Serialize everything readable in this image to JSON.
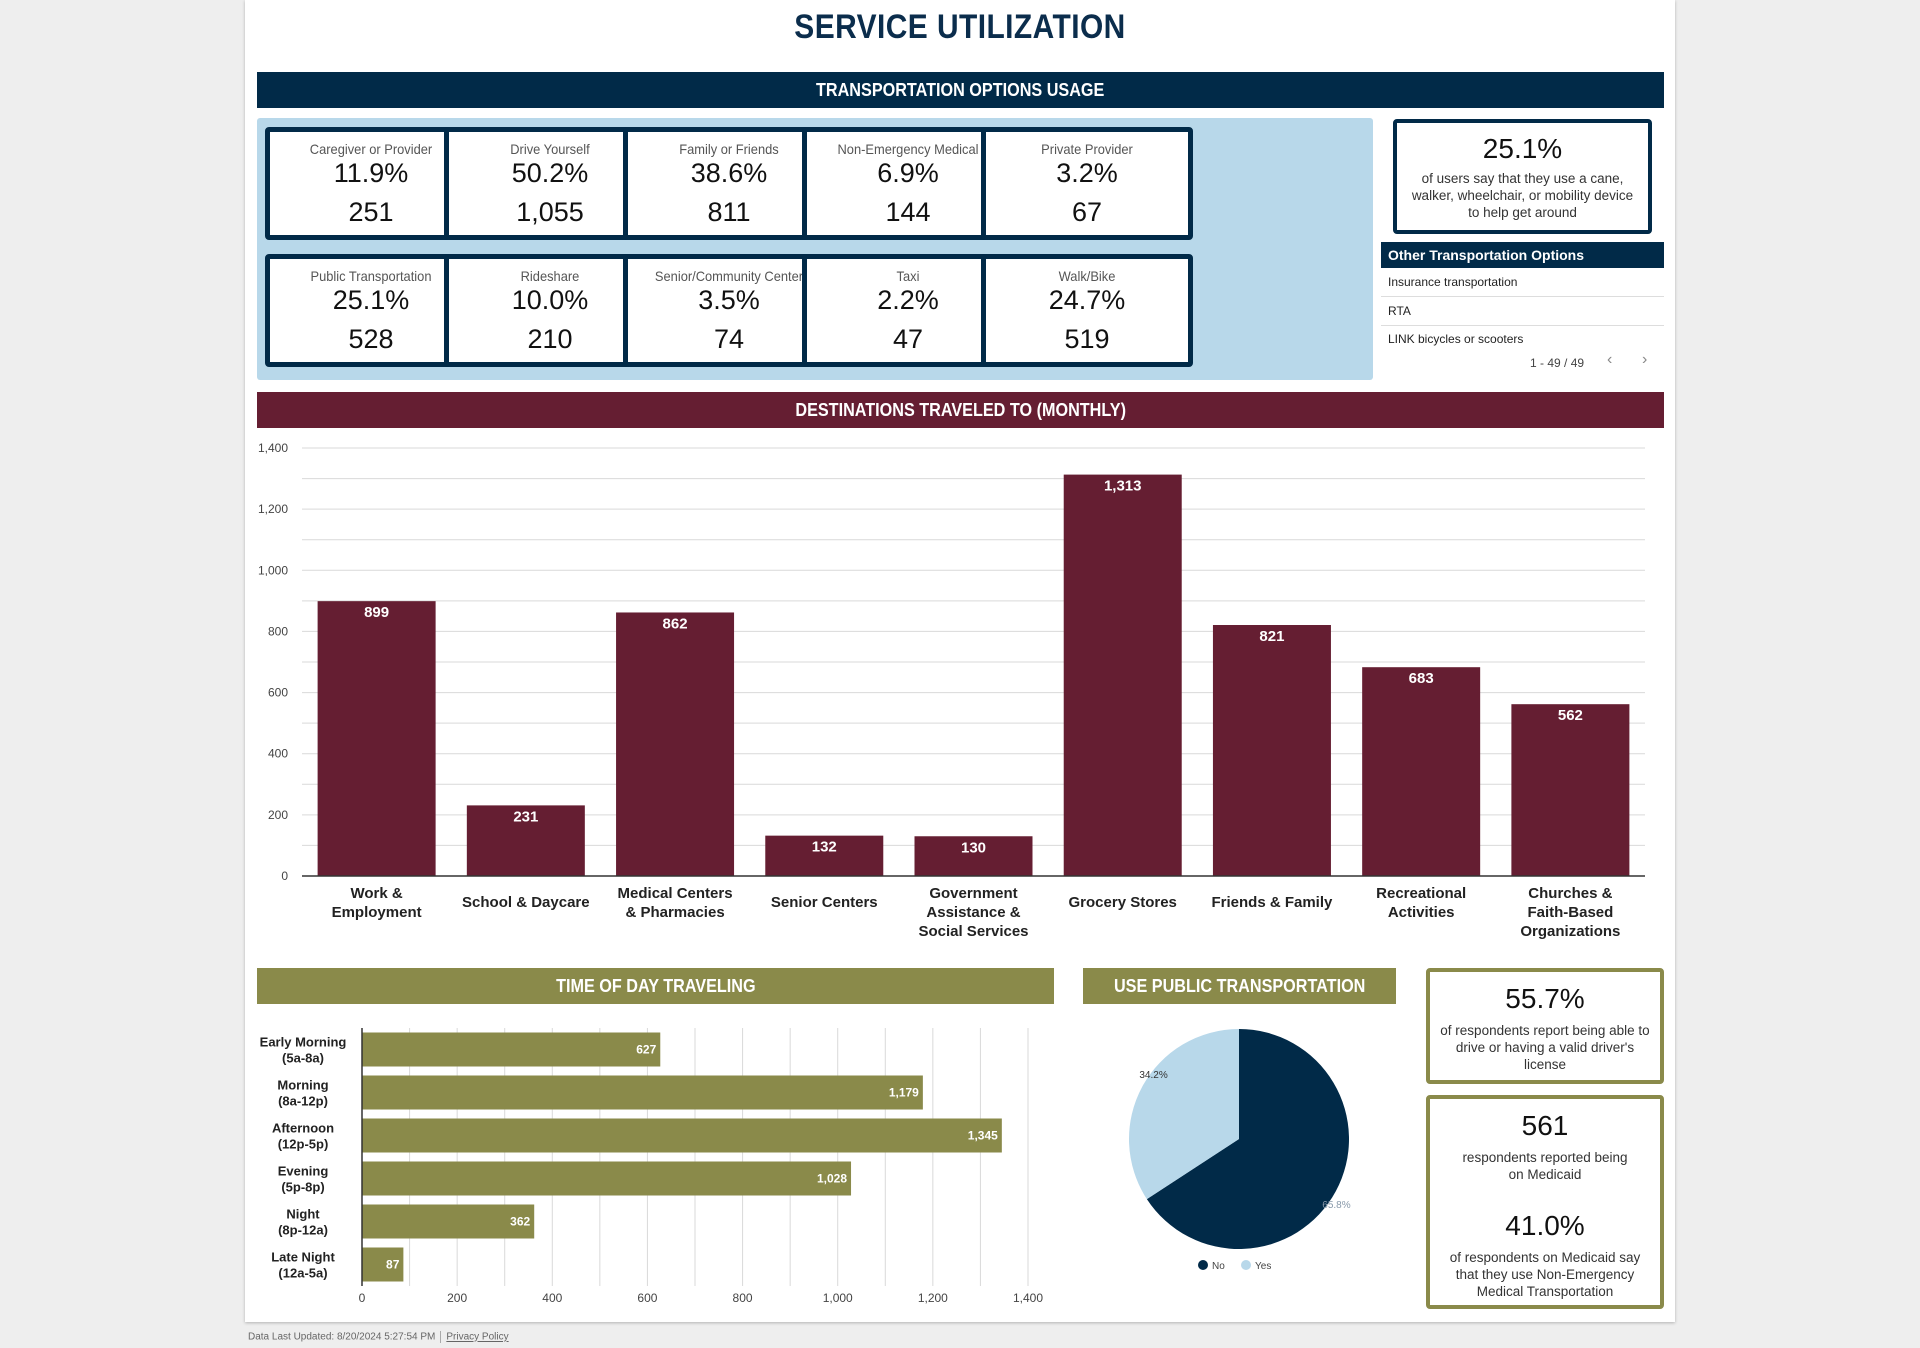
{
  "page": {
    "title": "SERVICE UTILIZATION"
  },
  "transportation": {
    "header": "TRANSPORTATION OPTIONS USAGE",
    "cards": [
      {
        "label": "Caregiver or Provider",
        "percent": "11.9%",
        "count": "251"
      },
      {
        "label": "Drive Yourself",
        "percent": "50.2%",
        "count": "1,055"
      },
      {
        "label": "Family or Friends",
        "percent": "38.6%",
        "count": "811"
      },
      {
        "label": "Non-Emergency Medical",
        "percent": "6.9%",
        "count": "144"
      },
      {
        "label": "Private Provider",
        "percent": "3.2%",
        "count": "67"
      },
      {
        "label": "Public Transportation",
        "percent": "25.1%",
        "count": "528"
      },
      {
        "label": "Rideshare",
        "percent": "10.0%",
        "count": "210"
      },
      {
        "label": "Senior/Community Center",
        "percent": "3.5%",
        "count": "74"
      },
      {
        "label": "Taxi",
        "percent": "2.2%",
        "count": "47"
      },
      {
        "label": "Walk/Bike",
        "percent": "24.7%",
        "count": "519"
      }
    ],
    "mobility_stat": {
      "value": "25.1%",
      "description": "of users say that they use a cane, walker, wheelchair, or mobility device to help get around"
    },
    "other_options": {
      "header": "Other Transportation Options",
      "items": [
        "Insurance transportation",
        "RTA",
        "LINK bicycles or scooters"
      ],
      "pagination": "1 - 49 / 49",
      "prev_icon": "‹",
      "next_icon": "›"
    }
  },
  "destinations": {
    "header": "DESTINATIONS TRAVELED TO (MONTHLY)"
  },
  "time_of_day": {
    "header": "TIME OF DAY TRAVELING"
  },
  "public_transport": {
    "header": "USE PUBLIC TRANSPORTATION"
  },
  "stats": {
    "license": {
      "value": "55.7%",
      "description": "of respondents report being able to drive or having a valid driver's license"
    },
    "medicaid": {
      "value": "561",
      "description": "respondents reported being on Medicaid"
    },
    "nemt": {
      "value": "41.0%",
      "description": "of respondents on Medicaid say that they use Non-Emergency Medical Transportation"
    }
  },
  "footer": {
    "updated": "Data Last Updated: 8/20/2024 5:27:54 PM",
    "privacy": "Privacy Policy"
  },
  "colors": {
    "navy": "#012a48",
    "maroon": "#651e32",
    "olive": "#8a8a4a",
    "light_blue": "#b8d8ea"
  },
  "chart_data": [
    {
      "type": "bar",
      "title": "DESTINATIONS TRAVELED TO (MONTHLY)",
      "categories": [
        "Work & Employment",
        "School & Daycare",
        "Medical Centers & Pharmacies",
        "Senior Centers",
        "Government Assistance & Social Services",
        "Grocery Stores",
        "Friends & Family",
        "Recreational Activities",
        "Churches & Faith-Based Organizations"
      ],
      "category_lines": [
        [
          "Work &",
          "Employment"
        ],
        [
          "School & Daycare"
        ],
        [
          "Medical Centers",
          "& Pharmacies"
        ],
        [
          "Senior Centers"
        ],
        [
          "Government",
          "Assistance &",
          "Social Services"
        ],
        [
          "Grocery Stores"
        ],
        [
          "Friends & Family"
        ],
        [
          "Recreational",
          "Activities"
        ],
        [
          "Churches &",
          "Faith-Based",
          "Organizations"
        ]
      ],
      "values": [
        899,
        231,
        862,
        132,
        130,
        1313,
        821,
        683,
        562
      ],
      "value_labels": [
        "899",
        "231",
        "862",
        "132",
        "130",
        "1,313",
        "821",
        "683",
        "562"
      ],
      "ylim": [
        0,
        1400
      ],
      "yticks": [
        0,
        200,
        400,
        600,
        800,
        1000,
        1200,
        1400
      ],
      "ytick_labels": [
        "0",
        "200",
        "400",
        "600",
        "800",
        "1,000",
        "1,200",
        "1,400"
      ],
      "minor_grid_step": 100,
      "xlabel": "",
      "ylabel": "",
      "grid": true,
      "color": "#651e32"
    },
    {
      "type": "bar",
      "orientation": "horizontal",
      "title": "TIME OF DAY TRAVELING",
      "categories": [
        "Early Morning (5a-8a)",
        "Morning (8a-12p)",
        "Afternoon (12p-5p)",
        "Evening (5p-8p)",
        "Night (8p-12a)",
        "Late Night (12a-5a)"
      ],
      "category_lines": [
        [
          "Early Morning",
          "(5a-8a)"
        ],
        [
          "Morning",
          "(8a-12p)"
        ],
        [
          "Afternoon",
          "(12p-5p)"
        ],
        [
          "Evening",
          "(5p-8p)"
        ],
        [
          "Night",
          "(8p-12a)"
        ],
        [
          "Late Night",
          "(12a-5a)"
        ]
      ],
      "values": [
        627,
        1179,
        1345,
        1028,
        362,
        87
      ],
      "value_labels": [
        "627",
        "1,179",
        "1,345",
        "1,028",
        "362",
        "87"
      ],
      "xlim": [
        0,
        1400
      ],
      "xticks": [
        0,
        200,
        400,
        600,
        800,
        1000,
        1200,
        1400
      ],
      "xtick_labels": [
        "0",
        "200",
        "400",
        "600",
        "800",
        "1,000",
        "1,200",
        "1,400"
      ],
      "minor_grid_step": 100,
      "grid": true,
      "color": "#8a8a4a"
    },
    {
      "type": "pie",
      "title": "USE PUBLIC TRANSPORTATION",
      "slices": [
        {
          "label": "No",
          "value": 65.8,
          "display": "65.8%",
          "color": "#012a48"
        },
        {
          "label": "Yes",
          "value": 34.2,
          "display": "34.2%",
          "color": "#b8d8ea"
        }
      ],
      "legend": "bottom"
    }
  ]
}
